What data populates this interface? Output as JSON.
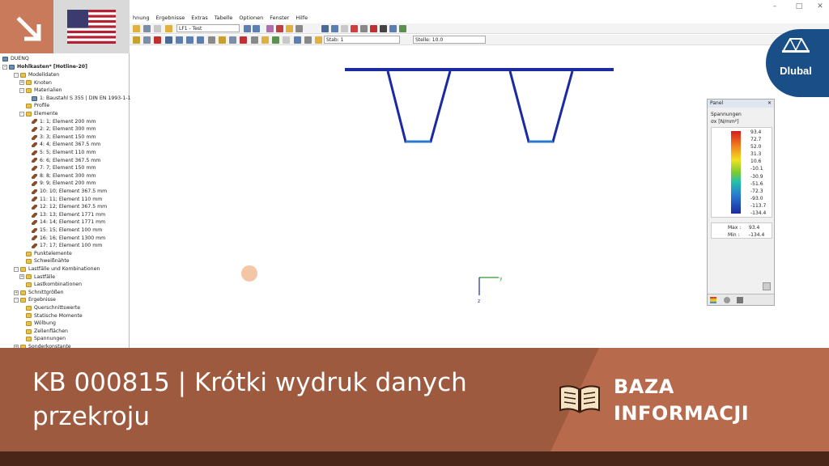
{
  "window": {
    "minimize": "–",
    "maximize": "□",
    "close": "✕"
  },
  "menu": [
    "hnung",
    "Ergebnisse",
    "Extras",
    "Tabelle",
    "Optionen",
    "Fenster",
    "Hilfe"
  ],
  "toolbar": {
    "load_case": "LF1 - Test",
    "stab_label": "Stab: 1",
    "stelle_label": "Stelle: 10.0"
  },
  "tree": {
    "root": "DUENQ",
    "project": "Hohlkasten* [Hotline-20]",
    "items": [
      {
        "label": "Modelldaten",
        "level": 1,
        "toggle": "-",
        "icon": "folder"
      },
      {
        "label": "Knoten",
        "level": 2,
        "toggle": "+",
        "icon": "folder"
      },
      {
        "label": "Materialien",
        "level": 2,
        "toggle": "-",
        "icon": "folder"
      },
      {
        "label": "1: Baustahl S 355 | DIN EN 1993-1-1:2",
        "level": 3,
        "toggle": "",
        "icon": "mat"
      },
      {
        "label": "Profile",
        "level": 2,
        "toggle": "",
        "icon": "folder"
      },
      {
        "label": "Elemente",
        "level": 2,
        "toggle": "-",
        "icon": "folder"
      },
      {
        "label": "1: 1; Element 200 mm",
        "level": 3,
        "toggle": "",
        "icon": "elem"
      },
      {
        "label": "2: 2; Element 300 mm",
        "level": 3,
        "toggle": "",
        "icon": "elem"
      },
      {
        "label": "3: 3; Element 150 mm",
        "level": 3,
        "toggle": "",
        "icon": "elem"
      },
      {
        "label": "4: 4; Element 367.5 mm",
        "level": 3,
        "toggle": "",
        "icon": "elem"
      },
      {
        "label": "5: 5; Element 110 mm",
        "level": 3,
        "toggle": "",
        "icon": "elem"
      },
      {
        "label": "6: 6; Element 367.5 mm",
        "level": 3,
        "toggle": "",
        "icon": "elem"
      },
      {
        "label": "7: 7; Element 150 mm",
        "level": 3,
        "toggle": "",
        "icon": "elem"
      },
      {
        "label": "8: 8; Element 300 mm",
        "level": 3,
        "toggle": "",
        "icon": "elem"
      },
      {
        "label": "9: 9; Element 200 mm",
        "level": 3,
        "toggle": "",
        "icon": "elem"
      },
      {
        "label": "10: 10; Element 367.5 mm",
        "level": 3,
        "toggle": "",
        "icon": "elem"
      },
      {
        "label": "11: 11; Element 110 mm",
        "level": 3,
        "toggle": "",
        "icon": "elem"
      },
      {
        "label": "12: 12; Element 367.5 mm",
        "level": 3,
        "toggle": "",
        "icon": "elem"
      },
      {
        "label": "13: 13; Element 1771 mm",
        "level": 3,
        "toggle": "",
        "icon": "elem"
      },
      {
        "label": "14: 14; Element 1771 mm",
        "level": 3,
        "toggle": "",
        "icon": "elem"
      },
      {
        "label": "15: 15; Element 100 mm",
        "level": 3,
        "toggle": "",
        "icon": "elem"
      },
      {
        "label": "16: 16; Element 1300 mm",
        "level": 3,
        "toggle": "",
        "icon": "elem"
      },
      {
        "label": "17: 17; Element 100 mm",
        "level": 3,
        "toggle": "",
        "icon": "elem"
      },
      {
        "label": "Punktelemente",
        "level": 2,
        "toggle": "",
        "icon": "folder"
      },
      {
        "label": "Schweißnähte",
        "level": 2,
        "toggle": "",
        "icon": "folder"
      },
      {
        "label": "Lastfälle und Kombinationen",
        "level": 1,
        "toggle": "-",
        "icon": "folder"
      },
      {
        "label": "Lastfälle",
        "level": 2,
        "toggle": "+",
        "icon": "folder"
      },
      {
        "label": "Lastkombinationen",
        "level": 2,
        "toggle": "",
        "icon": "folder"
      },
      {
        "label": "Schnittgrößen",
        "level": 1,
        "toggle": "+",
        "icon": "folder"
      },
      {
        "label": "Ergebnisse",
        "level": 1,
        "toggle": "-",
        "icon": "folder"
      },
      {
        "label": "Querschnittswerte",
        "level": 2,
        "toggle": "",
        "icon": "folder"
      },
      {
        "label": "Statische Momente",
        "level": 2,
        "toggle": "",
        "icon": "folder"
      },
      {
        "label": "Wölbung",
        "level": 2,
        "toggle": "",
        "icon": "folder"
      },
      {
        "label": "Zellenflächen",
        "level": 2,
        "toggle": "",
        "icon": "folder"
      },
      {
        "label": "Spannungen",
        "level": 2,
        "toggle": "",
        "icon": "folder"
      },
      {
        "label": "Sonderkonstante",
        "level": 1,
        "toggle": "+",
        "icon": "folder"
      }
    ]
  },
  "panel": {
    "title": "Panel",
    "close": "✕",
    "heading": "Spannungen",
    "unit": "σx [N/mm²]",
    "legend_values": [
      "93.4",
      "72.7",
      "52.0",
      "31.3",
      "10.6",
      "-10.1",
      "-30.9",
      "-51.6",
      "-72.3",
      "-93.0",
      "-113.7",
      "-134.4"
    ],
    "max_label": "Max :",
    "max_value": "93.4",
    "min_label": "Min :",
    "min_value": "-134.4"
  },
  "axes": {
    "y": "y",
    "z": "z"
  },
  "banner": {
    "title": "KB 000815 | Krótki wydruk danych przekroju",
    "category_line1": "BAZA",
    "category_line2": "INFORMACJI"
  },
  "brand": {
    "name": "Dlubal"
  },
  "colors": {
    "banner_left": "#9e5a3f",
    "banner_right": "#b86a4d",
    "footer": "#4a2618",
    "dlubal_blue": "#1a4e86",
    "corner_tile": "#c87a5a"
  }
}
